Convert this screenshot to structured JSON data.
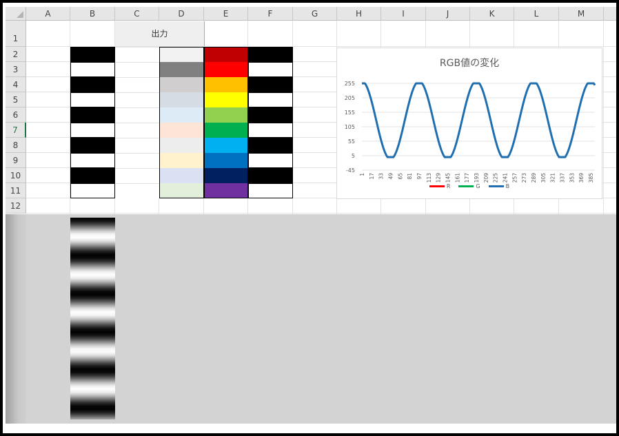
{
  "columns": [
    "A",
    "B",
    "C",
    "D",
    "E",
    "F",
    "G",
    "H",
    "I",
    "J",
    "K",
    "L",
    "M"
  ],
  "rows": [
    "1",
    "2",
    "3",
    "4",
    "5",
    "6",
    "7",
    "8",
    "9",
    "10",
    "11",
    "12"
  ],
  "selected_row": "7",
  "header_cell": "出力",
  "column_b_pattern": [
    "black",
    "white",
    "black",
    "white",
    "black",
    "white",
    "black",
    "white",
    "black",
    "white"
  ],
  "column_d_colors": [
    "#f2f2f2",
    "#808080",
    "#d0cece",
    "#d6dce4",
    "#ddebf7",
    "#fce4d6",
    "#ededed",
    "#fff2cc",
    "#d9e1f2",
    "#e2efda"
  ],
  "column_e_colors": [
    "#c00000",
    "#ff0000",
    "#ffc000",
    "#ffff00",
    "#92d050",
    "#00b050",
    "#00b0f0",
    "#0070c0",
    "#002060",
    "#7030a0"
  ],
  "column_f_pattern": [
    "black",
    "white",
    "black",
    "white",
    "black",
    "white",
    "black",
    "white",
    "black",
    "white"
  ],
  "chart_data": {
    "type": "line",
    "title": "RGB値の変化",
    "y_ticks": [
      "255",
      "205",
      "155",
      "105",
      "55",
      "5",
      "-45"
    ],
    "ylim": [
      -45,
      255
    ],
    "x_tick_labels": [
      "1",
      "17",
      "33",
      "49",
      "65",
      "81",
      "97",
      "113",
      "129",
      "145",
      "161",
      "177",
      "193",
      "209",
      "225",
      "241",
      "257",
      "273",
      "289",
      "305",
      "321",
      "337",
      "353",
      "369",
      "385"
    ],
    "series": [
      {
        "name": "R",
        "color": "#ff0000",
        "values": []
      },
      {
        "name": "G",
        "color": "#00b050",
        "values": []
      },
      {
        "name": "B",
        "color": "#1f6fb0",
        "values_description_formula": "cos wave 0..255, period 96"
      }
    ],
    "x_range": [
      1,
      392
    ],
    "period": 96,
    "legend_position": "bottom"
  }
}
